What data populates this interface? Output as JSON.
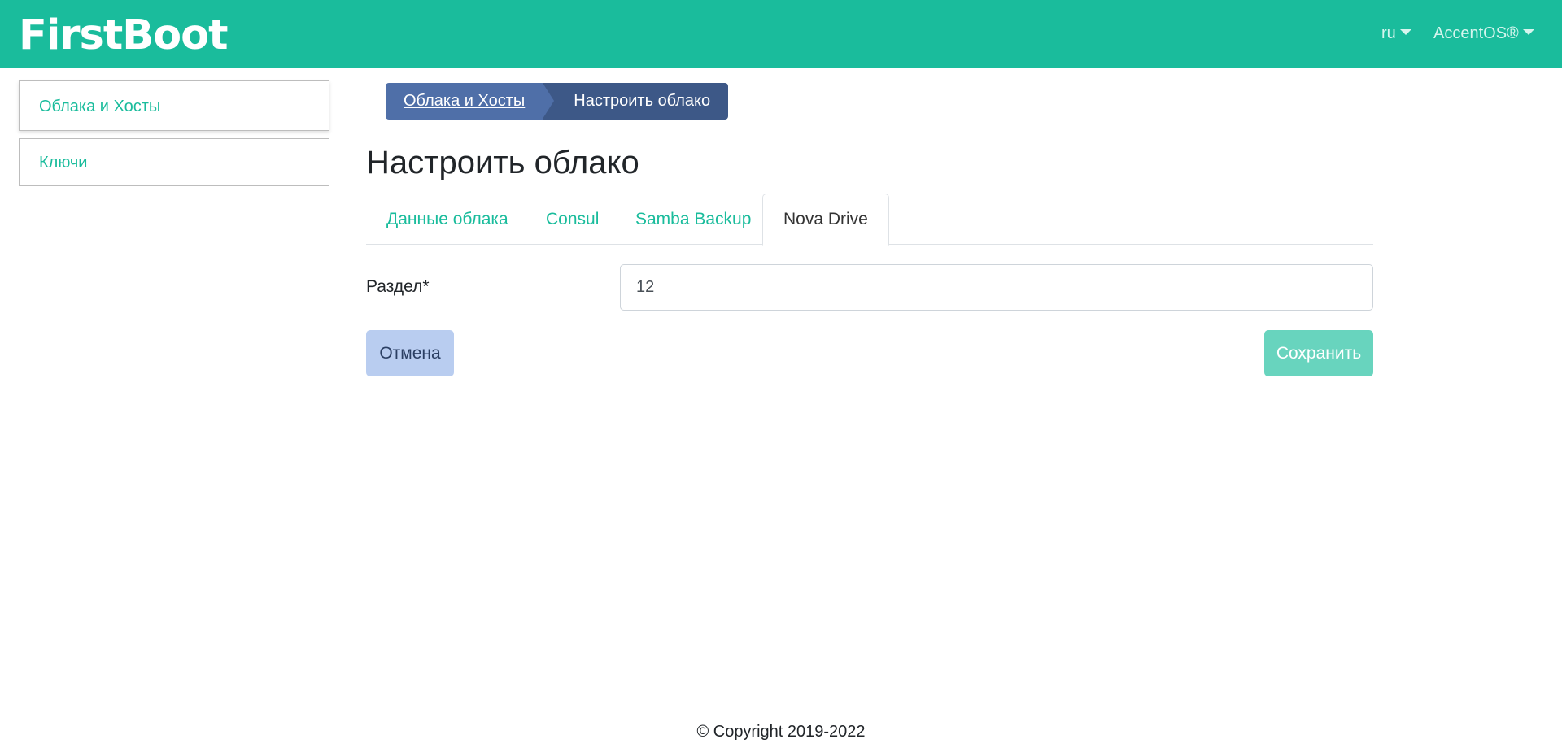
{
  "header": {
    "logo": "FirstBoot",
    "language": "ru",
    "user": "AccentOS®"
  },
  "sidebar": {
    "items": [
      {
        "label": "Облака и Хосты"
      },
      {
        "label": "Ключи"
      }
    ]
  },
  "breadcrumb": {
    "parent": "Облака и Хосты",
    "current": "Настроить облако"
  },
  "main": {
    "title": "Настроить облако",
    "tabs": [
      {
        "label": "Данные облака"
      },
      {
        "label": "Consul"
      },
      {
        "label": "Samba Backup"
      },
      {
        "label": "Nova Drive",
        "active": true
      }
    ],
    "form": {
      "section_label": "Раздел*",
      "section_value": "12"
    },
    "buttons": {
      "cancel": "Отмена",
      "save": "Сохранить"
    }
  },
  "footer": {
    "copyright": "© Copyright 2019-2022"
  },
  "colors": {
    "brand": "#1abc9c",
    "breadcrumb_parent": "#4f6fa8",
    "breadcrumb_current": "#3d5887",
    "cancel_button": "#b9cdf0",
    "save_button": "#68d4be"
  }
}
